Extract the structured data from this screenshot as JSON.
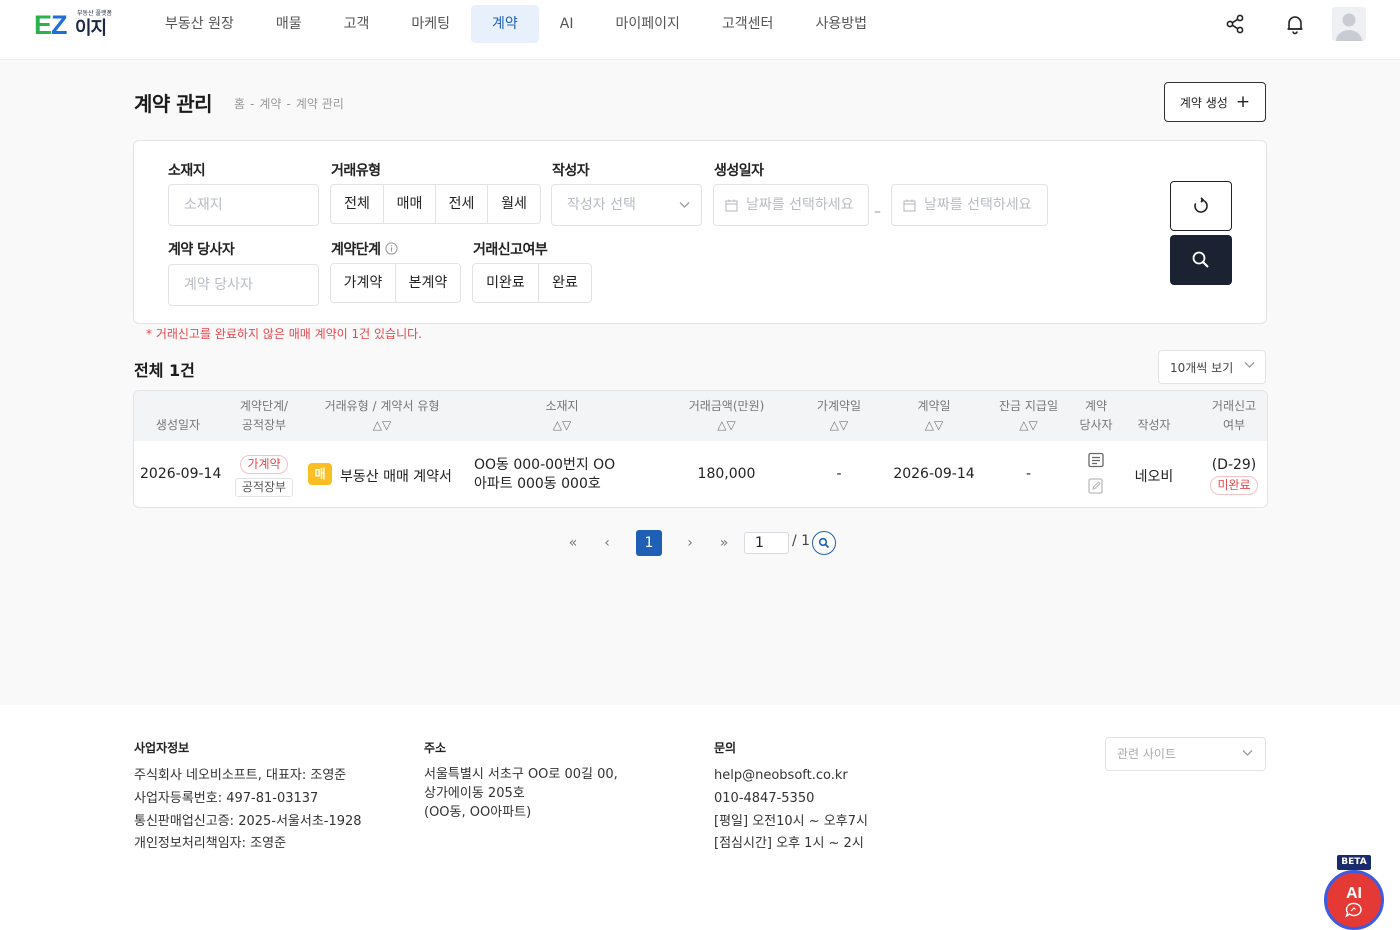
{
  "logo": {
    "brand_ez_e": "E",
    "brand_ez_z": "Z",
    "brand_izi": "이지",
    "tagline": "부동산 플랫폼"
  },
  "nav": [
    {
      "label": "부동산 원장",
      "active": false
    },
    {
      "label": "매물",
      "active": false
    },
    {
      "label": "고객",
      "active": false
    },
    {
      "label": "마케팅",
      "active": false
    },
    {
      "label": "계약",
      "active": true
    },
    {
      "label": "AI",
      "active": false
    },
    {
      "label": "마이페이지",
      "active": false
    },
    {
      "label": "고객센터",
      "active": false
    },
    {
      "label": "사용방법",
      "active": false
    }
  ],
  "page": {
    "title": "계약 관리",
    "breadcrumb": [
      "홈",
      "계약",
      "계약 관리"
    ],
    "breadcrumb_sep": "-",
    "create_label": "계약 생성"
  },
  "filters": {
    "location": {
      "label": "소재지",
      "placeholder": "소재지"
    },
    "trade_type": {
      "label": "거래유형",
      "options": [
        "전체",
        "매매",
        "전세",
        "월세"
      ]
    },
    "author": {
      "label": "작성자",
      "placeholder": "작성자 선택"
    },
    "created_date": {
      "label": "생성일자",
      "start_placeholder": "날짜를 선택하세요",
      "end_placeholder": "날짜를 선택하세요",
      "dash": "–"
    },
    "party": {
      "label": "계약 당사자",
      "placeholder": "계약 당사자"
    },
    "stage": {
      "label": "계약단계",
      "options": [
        "가계약",
        "본계약"
      ]
    },
    "report": {
      "label": "거래신고여부",
      "options": [
        "미완료",
        "완료"
      ]
    }
  },
  "warning": "* 거래신고를 완료하지 않은 매매 계약이 1건 있습니다.",
  "list": {
    "total": "전체 1건",
    "per_page": "10개씩 보기",
    "sort_arrows": "△▽",
    "columns": {
      "created": "생성일자",
      "stage_1": "계약단계/",
      "stage_2": "공적장부",
      "type": "거래유형 / 계약서 유형",
      "location": "소재지",
      "amount": "거래금액(만원)",
      "pre_date": "가계약일",
      "contract_date": "계약일",
      "balance_date": "잔금 지급일",
      "party_1": "계약",
      "party_2": "당사자",
      "author": "작성자",
      "report_1": "거래신고",
      "report_2": "여부"
    },
    "rows": [
      {
        "created": "2026-09-14",
        "stage": "가계약",
        "public_ledger": "공적장부",
        "type_badge": "매",
        "contract_type": "부동산 매매 계약서",
        "location_1": "OO동 000-00번지 OO",
        "location_2": "아파트 000동 000호",
        "amount": "180,000",
        "pre_date": "-",
        "contract_date": "2026-09-14",
        "balance_date": "-",
        "author": "네오비",
        "dday": "(D-29)",
        "report_status": "미완료"
      }
    ]
  },
  "pagination": {
    "first": "«",
    "prev": "‹",
    "current": "1",
    "next": "›",
    "last": "»",
    "input_value": "1",
    "total": "/ 1"
  },
  "footer": {
    "biz_title": "사업자정보",
    "biz_lines": [
      "주식회사 네오비소프트, 대표자: 조영준",
      "사업자등록번호: 497-81-03137",
      "통신판매업신고증: 2025-서울서초-1928",
      "개인정보처리책임자: 조영준"
    ],
    "addr_title": "주소",
    "addr_lines": [
      "서울특별시 서초구 OO로 00길 00,",
      "상가에이동 205호",
      "(OO동, OO아파트)"
    ],
    "contact_title": "문의",
    "contact_lines": [
      "help@neobsoft.co.kr",
      "010-4847-5350",
      "[평일] 오전10시 ~ 오후7시",
      "[점심시간] 오후 1시 ~ 2시"
    ],
    "related_sites": "관련 사이트"
  },
  "ai_button": {
    "label": "AI",
    "beta": "BETA"
  },
  "colors": {
    "primary": "#1f5fb5",
    "dark_button": "#1b2333",
    "warning": "#e5484d",
    "badge_yellow": "#fbbf24",
    "ai_red": "#e53935"
  },
  "icons": [
    "share-icon",
    "bell-icon",
    "user-avatar-icon",
    "plus-icon",
    "reset-icon",
    "search-icon",
    "calendar-icon",
    "chevron-down-icon",
    "info-icon",
    "document-icon",
    "edit-document-icon",
    "chat-icon"
  ]
}
